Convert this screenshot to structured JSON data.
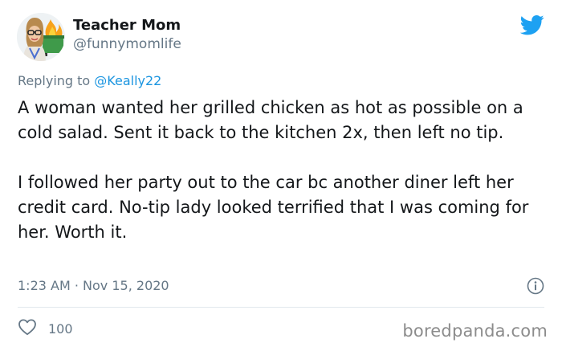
{
  "tweet": {
    "author": {
      "display_name": "Teacher Mom",
      "handle": "@funnymomlife",
      "avatar_icon": "avatar-cartoon-woman-burning-dumpster"
    },
    "reply": {
      "prefix": "Replying to ",
      "mention": "@Keally22"
    },
    "paragraphs": [
      "A woman wanted her grilled chicken as hot as possible on a cold salad. Sent it back to the kitchen 2x, then left no tip.",
      "I followed her party out to the car bc another diner left her credit card. No-tip lady looked terrified that I was coming for her. Worth it."
    ],
    "time": "1:23 AM",
    "separator": "·",
    "date": "Nov 15, 2020",
    "likes": "100",
    "brand_icon": "twitter-bird-icon",
    "colors": {
      "brand": "#1da1f2",
      "text": "#14171a",
      "muted": "#657786",
      "link": "#1b95e0"
    }
  },
  "watermark": "boredpanda.com"
}
